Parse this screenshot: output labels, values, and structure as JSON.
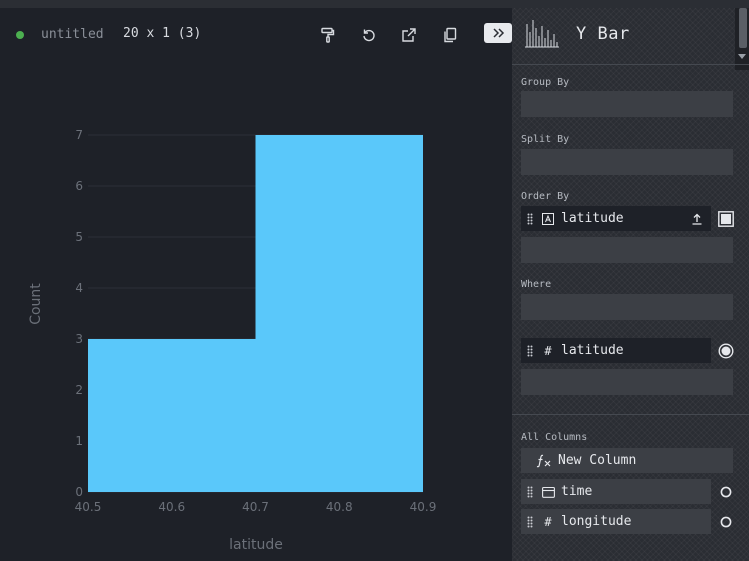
{
  "header": {
    "title": "untitled",
    "dimensions": "20 x 1 (3)",
    "status_color": "#4caf50"
  },
  "toolbar": {
    "icons": [
      "paint-roller-icon",
      "undo-icon",
      "export-icon",
      "copy-icon",
      "collapse-panel-icon"
    ]
  },
  "chart_data": {
    "type": "bar",
    "bins": [
      {
        "start": 40.5,
        "end": 40.7,
        "count": 3
      },
      {
        "start": 40.7,
        "end": 40.9,
        "count": 7
      }
    ],
    "x_ticks": [
      "40.5",
      "40.6",
      "40.7",
      "40.8",
      "40.9"
    ],
    "y_ticks": [
      "0",
      "1",
      "2",
      "3",
      "4",
      "5",
      "6",
      "7"
    ],
    "xlabel": "latitude",
    "ylabel": "Count",
    "xlim": [
      40.5,
      40.9
    ],
    "ylim": [
      0,
      7
    ],
    "bar_color": "#5ac8fa",
    "grid": true
  },
  "panel": {
    "plugin_name": "Y Bar",
    "plugin_icon": "bar-chart-icon",
    "group_by_label": "Group By",
    "split_by_label": "Split By",
    "order_by_label": "Order By",
    "order_by_column": "latitude",
    "where_label": "Where",
    "active_column": "latitude",
    "all_columns_label": "All Columns",
    "new_column_label": "New Column",
    "columns": [
      {
        "name": "time",
        "type_icon": "calendar-icon"
      },
      {
        "name": "longitude",
        "type_icon": "hash-icon"
      }
    ]
  }
}
